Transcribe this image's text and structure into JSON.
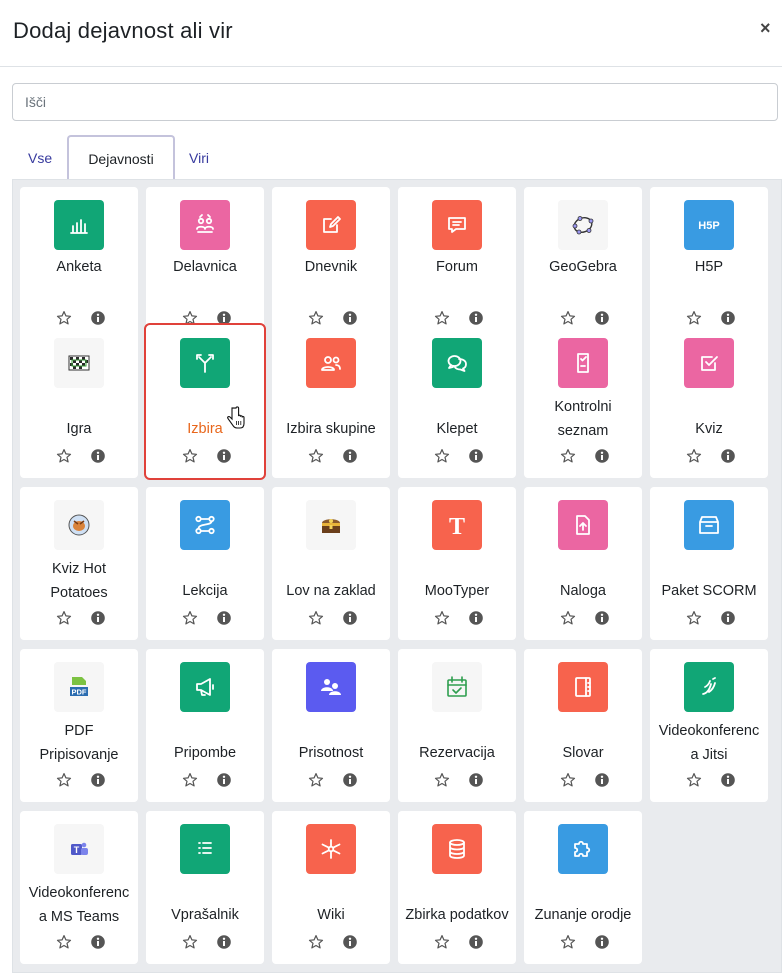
{
  "dialog": {
    "title": "Dodaj dejavnost ali vir",
    "close": "×"
  },
  "search": {
    "placeholder": "Išči"
  },
  "tabs": [
    {
      "label": "Vse",
      "active": false
    },
    {
      "label": "Dejavnosti",
      "active": true
    },
    {
      "label": "Viri",
      "active": false
    }
  ],
  "activities": [
    {
      "label": "Anketa",
      "icon": "bar-chart-icon",
      "color": "#11a676"
    },
    {
      "label": "Delavnica",
      "icon": "workshop-icon",
      "color": "#eb66a2"
    },
    {
      "label": "Dnevnik",
      "icon": "edit-note-icon",
      "color": "#f7634d"
    },
    {
      "label": "Forum",
      "icon": "chat-bubble-icon",
      "color": "#f7634d"
    },
    {
      "label": "GeoGebra",
      "icon": "geogebra-icon",
      "color": "#f6f6f6"
    },
    {
      "label": "H5P",
      "icon": "h5p-icon",
      "color": "#399be2"
    },
    {
      "label": "Igra",
      "icon": "game-icon",
      "color": "#f6f6f6"
    },
    {
      "label": "Izbira",
      "icon": "choice-arrows-icon",
      "color": "#11a676",
      "selected": true
    },
    {
      "label": "Izbira skupine",
      "icon": "group-choice-icon",
      "color": "#f7634d"
    },
    {
      "label": "Klepet",
      "icon": "chat-icon",
      "color": "#11a676"
    },
    {
      "label": "Kontrolni seznam",
      "label_lines": [
        "Kontrolni",
        "seznam"
      ],
      "icon": "checklist-icon",
      "color": "#eb66a2"
    },
    {
      "label": "Kviz",
      "icon": "quiz-checkbox-icon",
      "color": "#eb66a2"
    },
    {
      "label": "Kviz Hot Potatoes",
      "label_lines": [
        "Kviz Hot",
        "Potatoes"
      ],
      "icon": "hotpot-icon",
      "color": "#f6f6f6"
    },
    {
      "label": "Lekcija",
      "icon": "lesson-path-icon",
      "color": "#399be2"
    },
    {
      "label": "Lov na zaklad",
      "icon": "treasure-chest-icon",
      "color": "#f6f6f6"
    },
    {
      "label": "MooTyper",
      "icon": "mootyper-t-icon",
      "color": "#f7634d"
    },
    {
      "label": "Naloga",
      "icon": "assignment-upload-icon",
      "color": "#eb66a2"
    },
    {
      "label": "Paket SCORM",
      "icon": "package-box-icon",
      "color": "#399be2"
    },
    {
      "label": "PDF Pripisovanje",
      "label_lines": [
        "PDF",
        "Pripisovanje"
      ],
      "icon": "pdf-annotation-icon",
      "color": "#f6f6f6"
    },
    {
      "label": "Pripombe",
      "icon": "megaphone-icon",
      "color": "#11a676"
    },
    {
      "label": "Prisotnost",
      "icon": "attendance-icon",
      "color": "#5b5bf0"
    },
    {
      "label": "Rezervacija",
      "icon": "calendar-check-icon",
      "color": "#f6f6f6"
    },
    {
      "label": "Slovar",
      "icon": "glossary-book-icon",
      "color": "#f7634d"
    },
    {
      "label": "Videokonferenca Jitsi",
      "label_lines": [
        "Videokonferenc",
        "a Jitsi"
      ],
      "icon": "jitsi-icon",
      "color": "#11a676"
    },
    {
      "label": "Videokonferenca MS Teams",
      "label_lines": [
        "Videokonferenc",
        "a MS Teams"
      ],
      "icon": "ms-teams-icon",
      "color": "#f6f6f6"
    },
    {
      "label": "Vprašalnik",
      "icon": "questionnaire-list-icon",
      "color": "#11a676"
    },
    {
      "label": "Wiki",
      "icon": "wiki-network-icon",
      "color": "#f7634d"
    },
    {
      "label": "Zbirka podatkov",
      "icon": "database-icon",
      "color": "#f7634d"
    },
    {
      "label": "Zunanje orodje",
      "icon": "puzzle-icon",
      "color": "#399be2"
    }
  ]
}
